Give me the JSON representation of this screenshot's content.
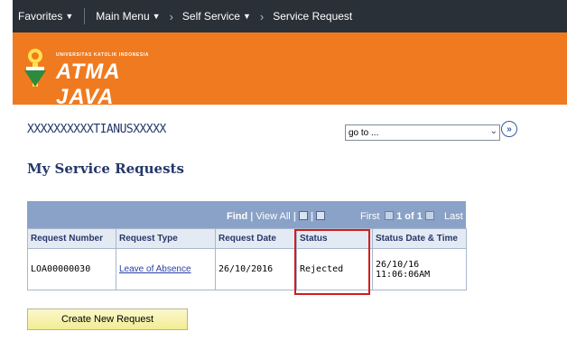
{
  "nav": {
    "favorites": "Favorites",
    "main_menu": "Main Menu",
    "self_service": "Self Service",
    "service_request": "Service Request"
  },
  "brand": {
    "small_text": "UNIVERSITAS KATOLIK INDONESIA",
    "name": "ATMA JAVA"
  },
  "user": {
    "name": "XXXXXXXXXXTIANUSXXXXX"
  },
  "goto": {
    "value": "go to ..."
  },
  "page": {
    "heading": "My Service Requests"
  },
  "grid": {
    "toolbar": {
      "find": "Find",
      "view_all": "View All",
      "first": "First",
      "count": "1 of 1",
      "last": "Last"
    },
    "headers": [
      "Request Number",
      "Request Type",
      "Request Date",
      "Status",
      "Status Date & Time"
    ],
    "rows": [
      {
        "request_number": "LOA00000030",
        "request_type": "Leave of Absence",
        "request_date": "26/10/2016",
        "status": "Rejected",
        "status_date": "26/10/16",
        "status_time": "11:06:06AM"
      }
    ]
  },
  "actions": {
    "create_new": "Create New Request"
  },
  "colors": {
    "nav_bg": "#2a3038",
    "banner_orange": "#f07a1f",
    "grid_header_blue": "#8aa2c7",
    "highlight_red": "#d31c1c"
  }
}
